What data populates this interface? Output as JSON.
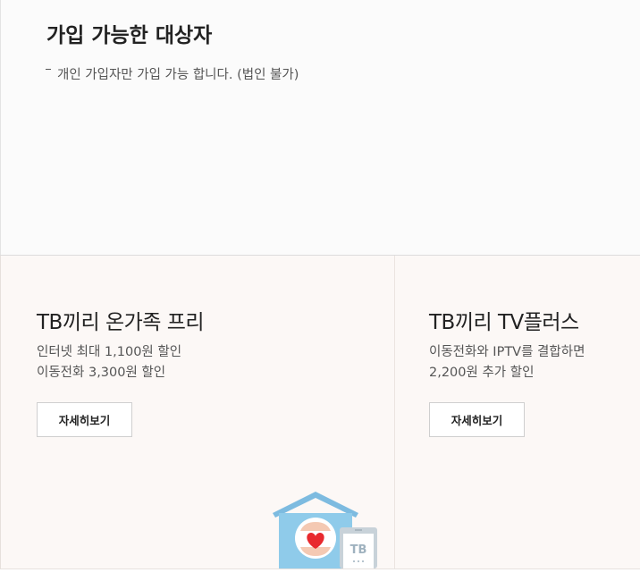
{
  "eligibility": {
    "title": "가입 가능한 대상자",
    "bullet": "개인 가입자만 가입 가능 합니다. (법인 불가)"
  },
  "cards": [
    {
      "title": "TB끼리 온가족 프리",
      "desc_line1": "인터넷 최대 1,100원 할인",
      "desc_line2": "이동전화 3,300원 할인",
      "button_label": "자세히보기"
    },
    {
      "title": "TB끼리 TV플러스",
      "desc_line1": "이동전화와 IPTV를 결합하면",
      "desc_line2": "2,200원 추가 할인",
      "button_label": "자세히보기"
    }
  ],
  "illustration": {
    "tablet_label": "TB",
    "icon_names": [
      "house-icon",
      "heart-icon",
      "tablet-icon"
    ],
    "colors": {
      "house": "#8fcbea",
      "roof": "#7dbbe0",
      "heart": "#e8292e",
      "tablet": "#c8d2d9"
    }
  }
}
